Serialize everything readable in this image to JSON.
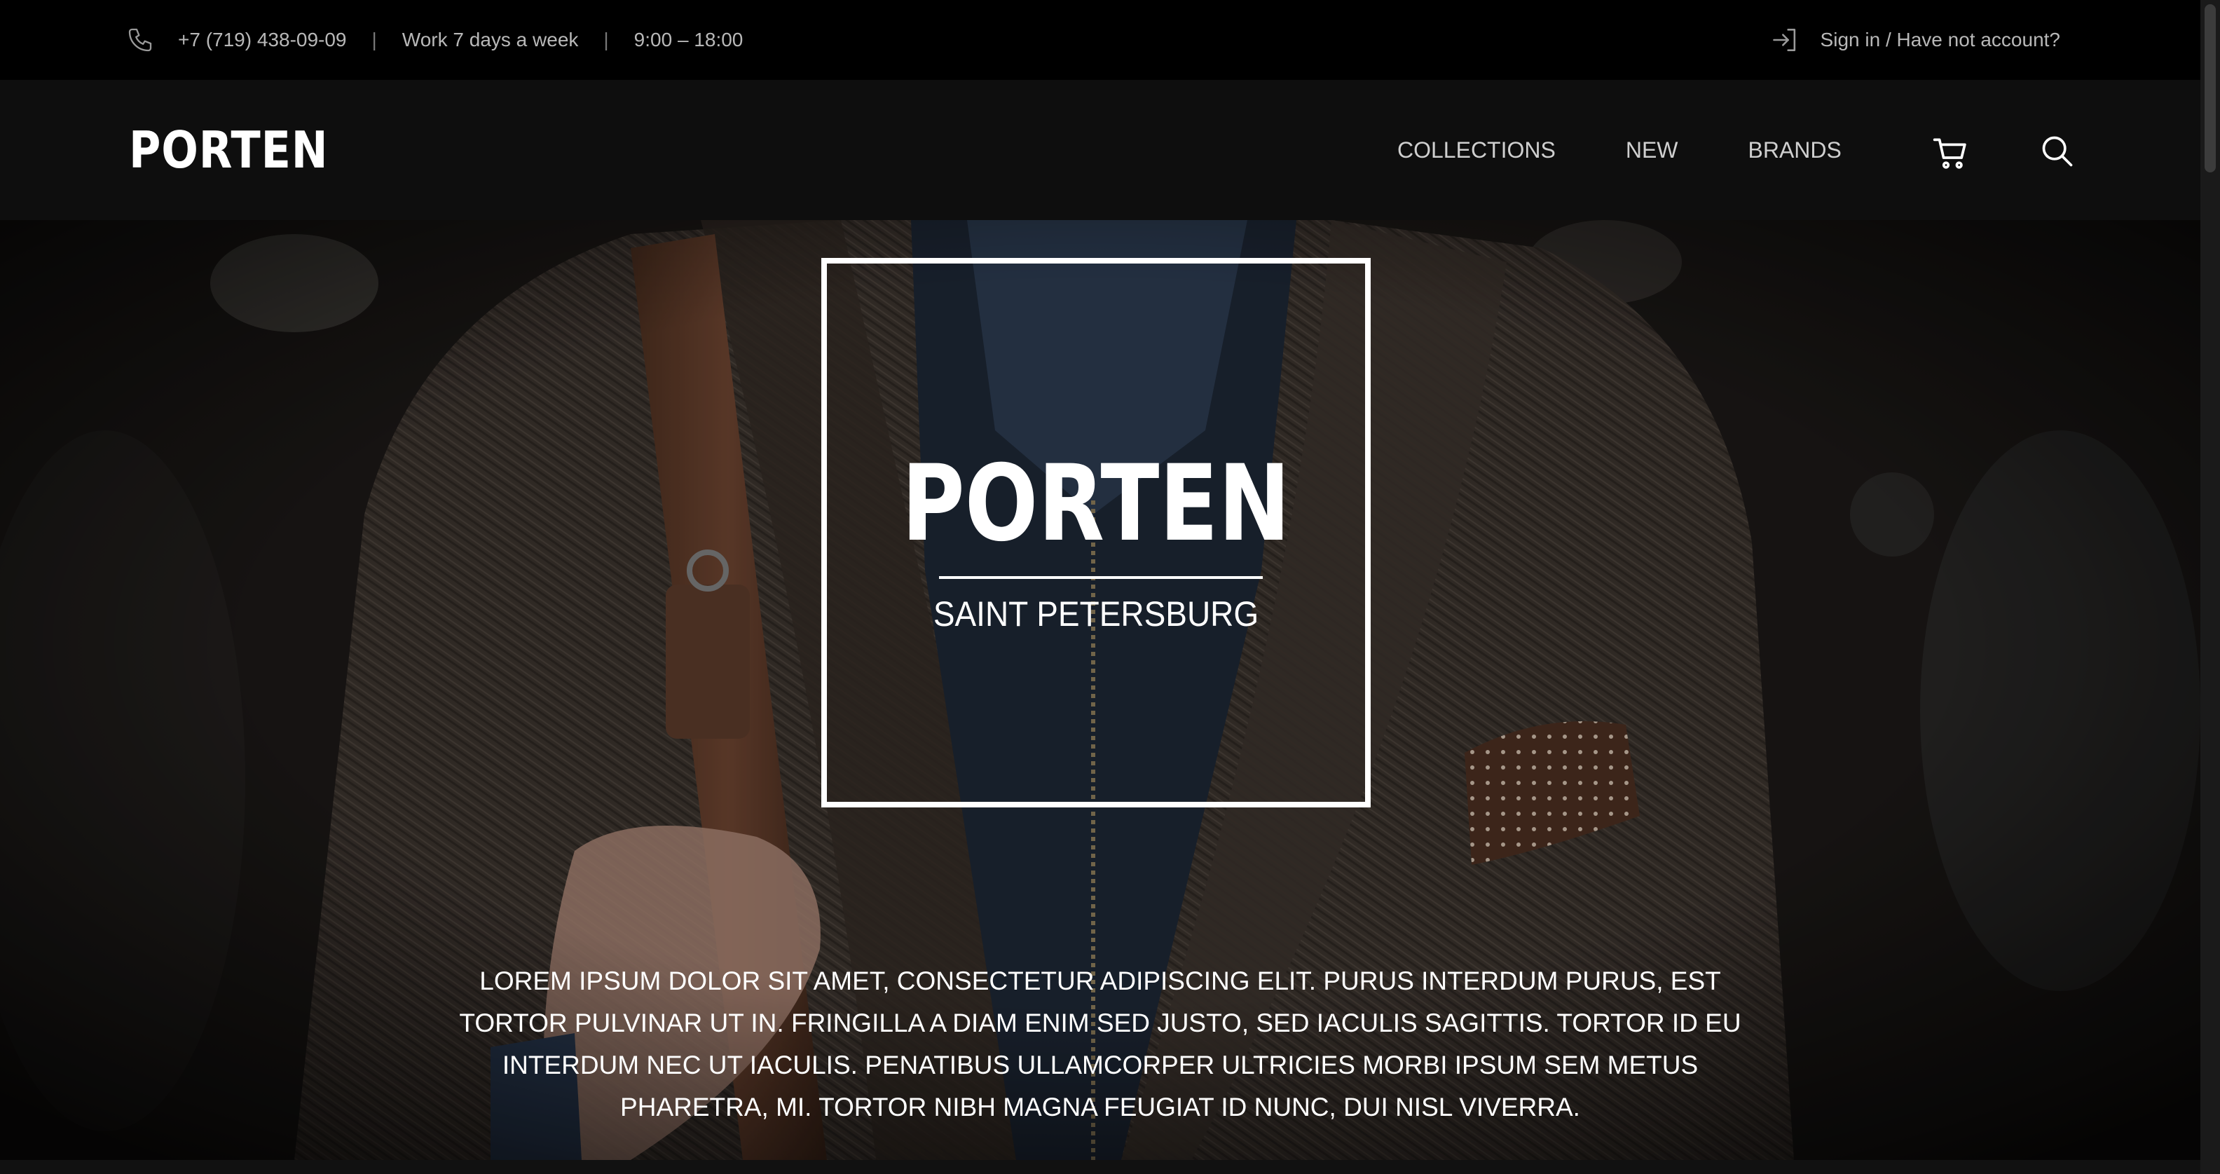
{
  "topbar": {
    "phone": "+7 (719) 438-09-09",
    "work_days": "Work 7 days a week",
    "hours": "9:00 – 18:00",
    "signin": "Sign in / Have not account?"
  },
  "header": {
    "logo": "PORTEN",
    "nav": [
      {
        "label": "COLLECTIONS"
      },
      {
        "label": "NEW"
      },
      {
        "label": "BRANDS"
      }
    ]
  },
  "hero": {
    "title": "PORTEN",
    "subtitle": "SAINT PETERSBURG",
    "description": "Lorem ipsum dolor sit amet, consectetur adipiscing elit. Purus interdum purus, est tortor pulvinar ut in. Fringilla a diam enim sed justo, sed iaculis sagittis. Tortor id eu interdum nec ut iaculis. Penatibus ullamcorper ultricies morbi ipsum sem metus pharetra, mi. Tortor nibh magna feugiat id nunc, dui nisl viverra."
  },
  "icons": {
    "phone": "phone-icon",
    "signin": "sign-in-icon",
    "cart": "cart-icon",
    "search": "search-icon"
  },
  "colors": {
    "topbar_bg": "#000000",
    "header_bg": "#0e0e0e",
    "text_muted": "#b8b8b8",
    "nav_text": "#cfcfcf",
    "hero_text": "#ffffff"
  }
}
